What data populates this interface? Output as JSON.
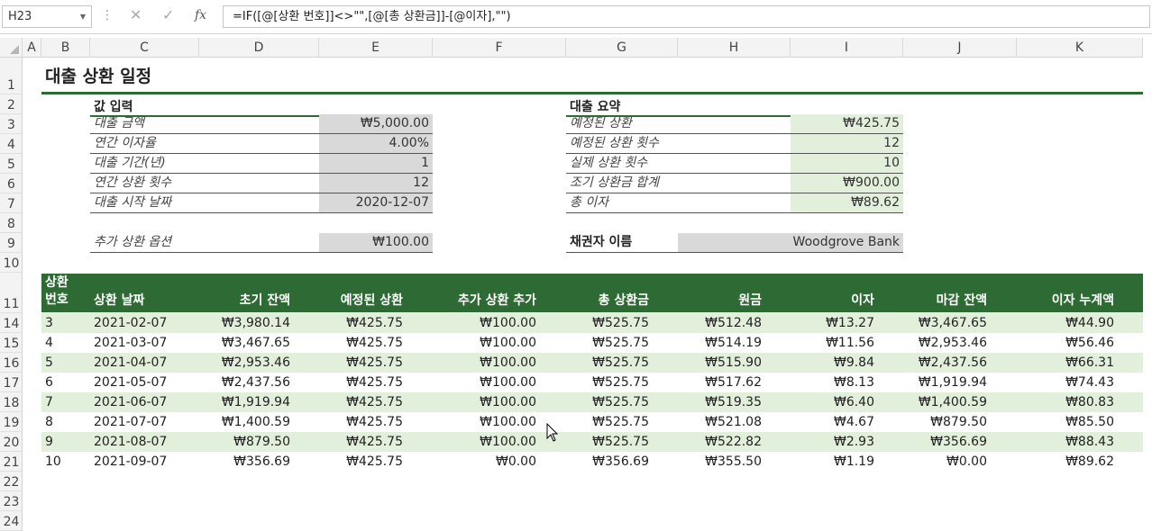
{
  "formula_bar": {
    "name_box": "H23",
    "formula": "=IF([@[상환 번호]]<>\"\",[@[총 상환금]]-[@이자],\"\")"
  },
  "columns": [
    "A",
    "B",
    "C",
    "D",
    "E",
    "F",
    "G",
    "H",
    "I",
    "J",
    "K"
  ],
  "rows": [
    "1",
    "2",
    "3",
    "4",
    "5",
    "6",
    "7",
    "8",
    "9",
    "10",
    "11",
    "14",
    "15",
    "16",
    "17",
    "18",
    "19",
    "20",
    "21",
    "22",
    "23",
    "24"
  ],
  "title": "대출 상환 일정",
  "inputs": {
    "section": "값 입력",
    "items": [
      {
        "label": "대출 금액",
        "value": "₩5,000.00"
      },
      {
        "label": "연간 이자율",
        "value": "4.00%"
      },
      {
        "label": "대출 기간(년)",
        "value": "1"
      },
      {
        "label": "연간 상환 횟수",
        "value": "12"
      },
      {
        "label": "대출 시작 날짜",
        "value": "2020-12-07"
      }
    ],
    "extra": {
      "label": "추가 상환 옵션",
      "value": "₩100.00"
    }
  },
  "summary": {
    "section": "대출 요약",
    "items": [
      {
        "label": "예정된 상환",
        "value": "₩425.75"
      },
      {
        "label": "예정된 상환 횟수",
        "value": "12"
      },
      {
        "label": "실제 상환 횟수",
        "value": "10"
      },
      {
        "label": "조기 상환금 합계",
        "value": "₩900.00"
      },
      {
        "label": "총 이자",
        "value": "₩89.62"
      }
    ],
    "lender": {
      "label": "채권자 이름",
      "value": "Woodgrove Bank"
    }
  },
  "table": {
    "headers": [
      "상환\n번호",
      "상환 날짜",
      "초기 잔액",
      "예정된 상환",
      "추가 상환 추가",
      "총 상환금",
      "원금",
      "이자",
      "마감 잔액",
      "이자 누계액"
    ],
    "rows": [
      [
        "3",
        "2021-02-07",
        "₩3,980.14",
        "₩425.75",
        "₩100.00",
        "₩525.75",
        "₩512.48",
        "₩13.27",
        "₩3,467.65",
        "₩44.90"
      ],
      [
        "4",
        "2021-03-07",
        "₩3,467.65",
        "₩425.75",
        "₩100.00",
        "₩525.75",
        "₩514.19",
        "₩11.56",
        "₩2,953.46",
        "₩56.46"
      ],
      [
        "5",
        "2021-04-07",
        "₩2,953.46",
        "₩425.75",
        "₩100.00",
        "₩525.75",
        "₩515.90",
        "₩9.84",
        "₩2,437.56",
        "₩66.31"
      ],
      [
        "6",
        "2021-05-07",
        "₩2,437.56",
        "₩425.75",
        "₩100.00",
        "₩525.75",
        "₩517.62",
        "₩8.13",
        "₩1,919.94",
        "₩74.43"
      ],
      [
        "7",
        "2021-06-07",
        "₩1,919.94",
        "₩425.75",
        "₩100.00",
        "₩525.75",
        "₩519.35",
        "₩6.40",
        "₩1,400.59",
        "₩80.83"
      ],
      [
        "8",
        "2021-07-07",
        "₩1,400.59",
        "₩425.75",
        "₩100.00",
        "₩525.75",
        "₩521.08",
        "₩4.67",
        "₩879.50",
        "₩85.50"
      ],
      [
        "9",
        "2021-08-07",
        "₩879.50",
        "₩425.75",
        "₩100.00",
        "₩525.75",
        "₩522.82",
        "₩2.93",
        "₩356.69",
        "₩88.43"
      ],
      [
        "10",
        "2021-09-07",
        "₩356.69",
        "₩425.75",
        "₩0.00",
        "₩356.69",
        "₩355.50",
        "₩1.19",
        "₩0.00",
        "₩89.62"
      ]
    ]
  },
  "colors": {
    "accent": "#2e6b34",
    "band": "#e2efda",
    "input_fill": "#d9d9d9"
  }
}
